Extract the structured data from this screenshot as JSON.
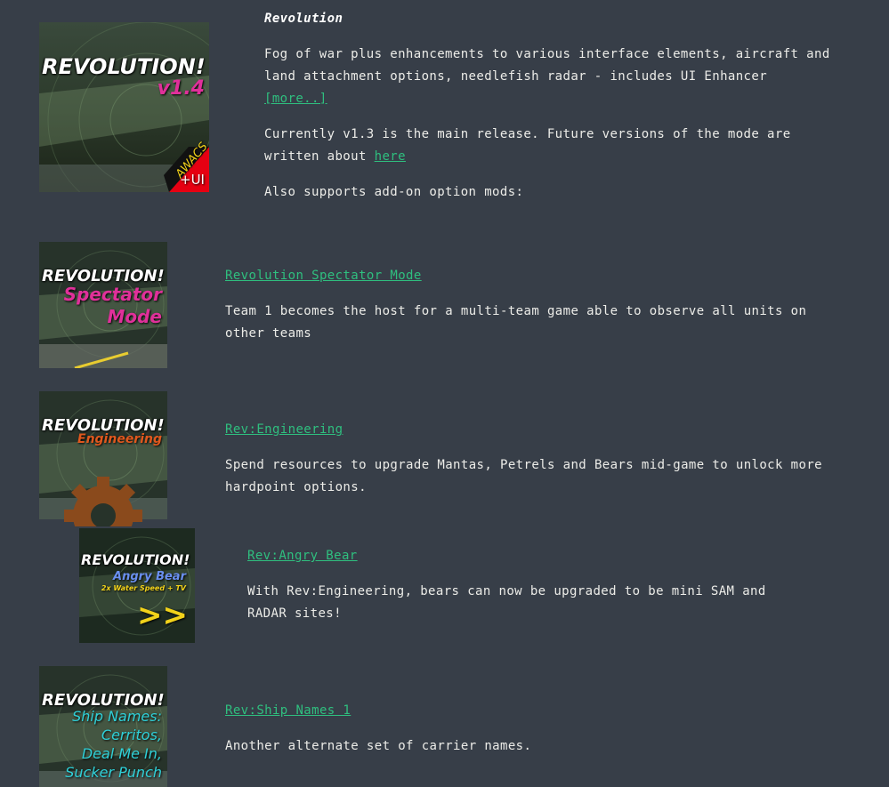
{
  "main_mod": {
    "title": "Revolution",
    "description": "Fog of war plus enhancements to various interface elements, aircraft and land attachment options, needlefish radar - includes UI Enhancer",
    "more_link": "[more..]",
    "release_text": "Currently v1.3 is the main release. Future versions of the mode are written about",
    "here_link": "here",
    "addons_text": "Also supports add-on option mods:",
    "thumb": {
      "title": "REVOLUTION!",
      "version": "v1.4",
      "badge_top": "AWACS",
      "badge_bottom": "+UI"
    }
  },
  "addons": [
    {
      "link": "Revolution Spectator Mode",
      "description": "Team 1 becomes the host for a multi-team game able to observe all units on other teams",
      "thumb_title": "REVOLUTION!",
      "thumb_sub": [
        "Spectator",
        "Mode"
      ]
    },
    {
      "link": "Rev:Engineering",
      "description": "Spend resources to upgrade Mantas, Petrels and Bears mid-game to unlock more hardpoint options.",
      "thumb_title": "REVOLUTION!",
      "thumb_sub": [
        "Engineering"
      ]
    },
    {
      "link": "Rev:Angry Bear",
      "description": "With Rev:Engineering, bears can now be upgraded to be mini SAM and RADAR sites!",
      "thumb_title": "REVOLUTION!",
      "thumb_sub": [
        "Angry Bear",
        "2x Water Speed + TV"
      ],
      "thumb_arrows": ">>"
    },
    {
      "link": "Rev:Ship Names 1",
      "description": "Another alternate set of carrier names.",
      "thumb_title": "REVOLUTION!",
      "thumb_sub": [
        "Ship Names:",
        "Cerritos,",
        "Deal Me In,",
        "Sucker Punch"
      ]
    }
  ],
  "colors": {
    "background": "#373e48",
    "link": "#2fbf7f",
    "text": "#ecece8",
    "pink": "#e0309a",
    "orange": "#e0581e",
    "blue": "#6a8ff0",
    "yellow": "#f2d21a",
    "cyan": "#2fd0d8"
  }
}
